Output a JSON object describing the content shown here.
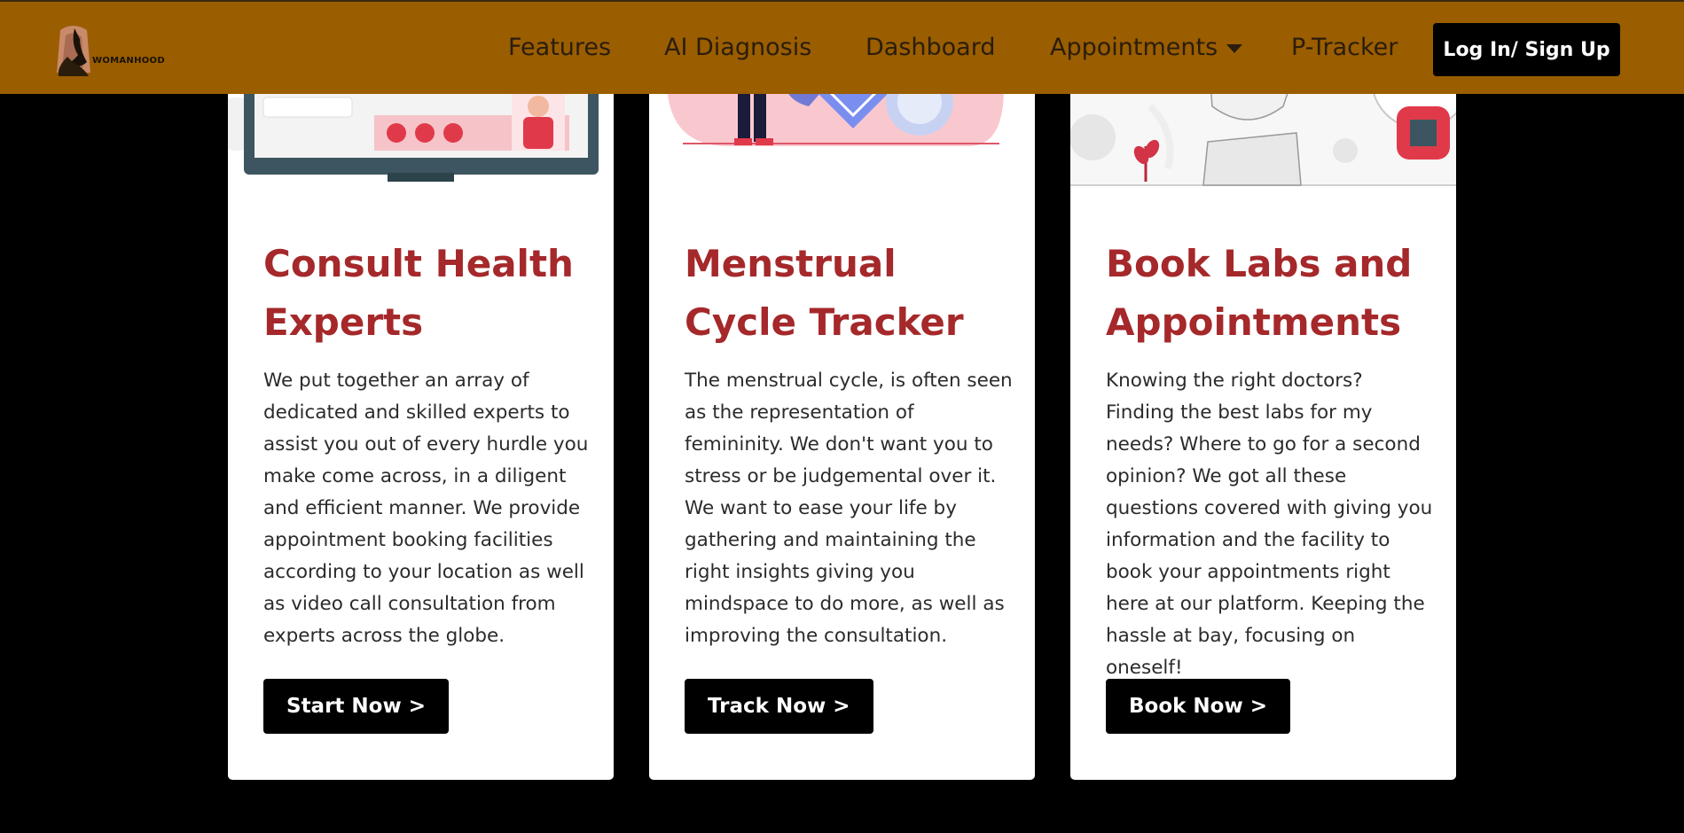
{
  "brand": {
    "logo_text": "WOMANHOOD"
  },
  "nav": {
    "features": "Features",
    "ai_diagnosis": "AI Diagnosis",
    "dashboard": "Dashboard",
    "appointments": "Appointments",
    "p_tracker": "P-Tracker",
    "login": "Log In/ Sign Up"
  },
  "cards": [
    {
      "title": "Consult Health Experts",
      "description": "We put together an array of dedicated and skilled experts to assist you out of every hurdle you make come across, in a diligent and efficient manner. We provide appointment booking facilities according to your location as well as video call consultation from experts across the globe.",
      "button": "Start Now >"
    },
    {
      "title": "Menstrual Cycle Tracker",
      "description": "The menstrual cycle, is often seen as the representation of femininity. We don't want you to stress or be judgemental over it. We want to ease your life by gathering and maintaining the right insights giving you mindspace to do more, as well as improving the consultation.",
      "button": "Track Now >"
    },
    {
      "title": "Book Labs and Appointments",
      "description": "Knowing the right doctors? Finding the best labs for my needs? Where to go for a second opinion? We got all these questions covered with giving you information and the facility to book your appointments right here at our platform. Keeping the hassle at bay, focusing on oneself!",
      "button": "Book Now >"
    }
  ],
  "colors": {
    "navbar": "#9a5d00",
    "title": "#a5282a",
    "background": "#000000"
  }
}
